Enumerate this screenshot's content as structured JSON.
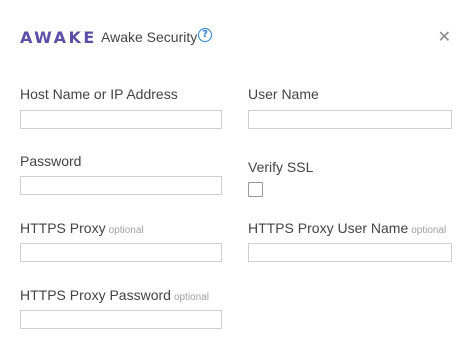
{
  "header": {
    "logo_text": "AWAKE",
    "title": "Awake Security",
    "help_icon": "question-circle-icon",
    "close_glyph": "✕",
    "accent_color": "#5b4fa8",
    "help_color": "#2f7fd6"
  },
  "form": {
    "host": {
      "label": "Host Name or IP Address",
      "value": "",
      "placeholder": ""
    },
    "username": {
      "label": "User Name",
      "value": "",
      "placeholder": ""
    },
    "password": {
      "label": "Password",
      "value": "",
      "placeholder": ""
    },
    "verify_ssl": {
      "label": "Verify SSL",
      "checked": false
    },
    "proxy": {
      "label": "HTTPS Proxy",
      "optional": "optional",
      "value": "",
      "placeholder": ""
    },
    "proxy_user": {
      "label": "HTTPS Proxy User Name",
      "optional": "optional",
      "value": "",
      "placeholder": ""
    },
    "proxy_password": {
      "label": "HTTPS Proxy Password",
      "optional": "optional",
      "value": "",
      "placeholder": ""
    }
  }
}
